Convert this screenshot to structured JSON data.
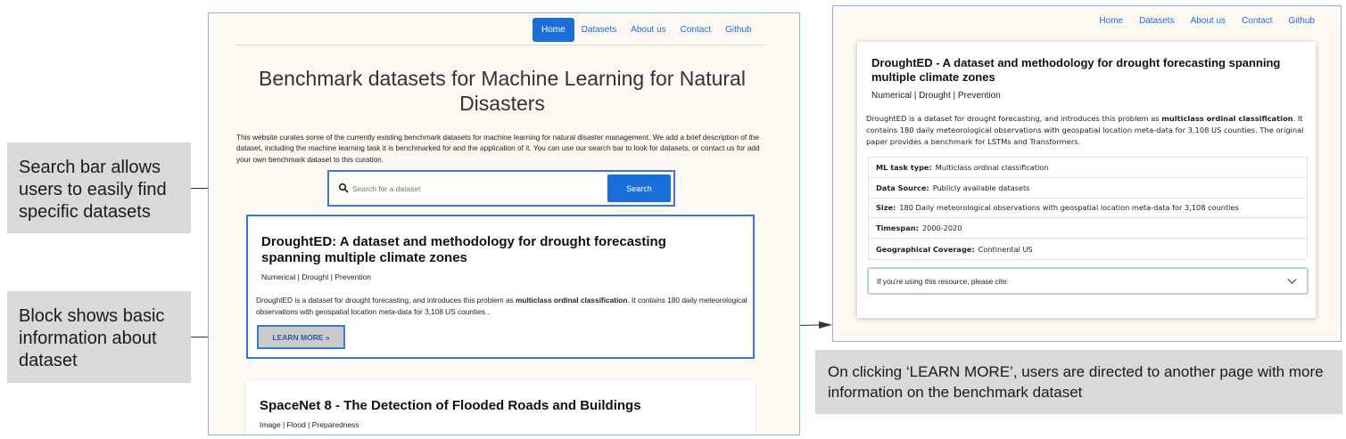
{
  "callouts": {
    "search": "Search bar allows users to easily find specific datasets",
    "block": "Block shows basic information about dataset",
    "learn_more": "On clicking ‘LEARN MORE’, users are directed to another page with more information on the benchmark dataset"
  },
  "home_page": {
    "nav": [
      "Home",
      "Datasets",
      "About us",
      "Contact",
      "Github"
    ],
    "active_nav": "Home",
    "title": "Benchmark datasets for Machine Learning for Natural Disasters",
    "intro": "This website curates some of the currently existing benchmark datasets for machine learning for natural disaster management. We add a brief description of the dataset, including the machine learning task it is benchmarked for and the application of it. You can use our search bar to look for datasets, or contact us for add your own benchmark dataset to this curation.",
    "search": {
      "placeholder": "Search for a dataset",
      "button": "Search",
      "icon": "search-icon"
    },
    "cards": [
      {
        "title": "DroughtED: A dataset and methodology for drought forecasting spanning multiple climate zones",
        "tags": "Numerical | Drought | Prevention",
        "desc_before": "DroughtED is a dataset for drought forecasting, and introduces this problem as ",
        "desc_bold": "multiclass ordinal classification",
        "desc_after": ". It contains 180 daily meteorological observations with geospatial location meta-data for 3,108 US counties..",
        "button": "LEARN MORE »"
      },
      {
        "title": "SpaceNet 8 - The Detection of Flooded Roads and Buildings",
        "tags": "Image | Flood | Preparedness"
      }
    ]
  },
  "detail_page": {
    "nav": [
      "Home",
      "Datasets",
      "About us",
      "Contact",
      "Github"
    ],
    "title": "DroughtED - A dataset and methodology for drought forecasting spanning multiple climate zones",
    "tags": "Numerical | Drought | Prevention",
    "desc_before": "DroughtED is a dataset for drought forecasting, and introduces this problem as ",
    "desc_bold": "multiclass ordinal classification",
    "desc_after": ". It contains 180 daily meteorological observations with geospatial location meta-data for 3,108 US counties. The original paper provides a benchmark for LSTMs and Transformers.",
    "rows": [
      {
        "label": "ML task type:",
        "value": "Multiclass ordinal classification"
      },
      {
        "label": "Data Source:",
        "value": "Publicly available datasets"
      },
      {
        "label": "Size:",
        "value": "180 Daily meteorological observations with geospatial location meta-data for 3,108 counties"
      },
      {
        "label": "Timespan:",
        "value": "2000-2020"
      },
      {
        "label": "Geographical Coverage:",
        "value": "Continental US"
      }
    ],
    "cite": "If you're using this resource, please cite:",
    "cite_icon": "chevron-down-icon"
  },
  "colors": {
    "accent": "#1a6ed8",
    "highlight_border": "#3a78d4",
    "page_bg": "#fdf8f2",
    "callout_bg": "#d9d9d9"
  }
}
